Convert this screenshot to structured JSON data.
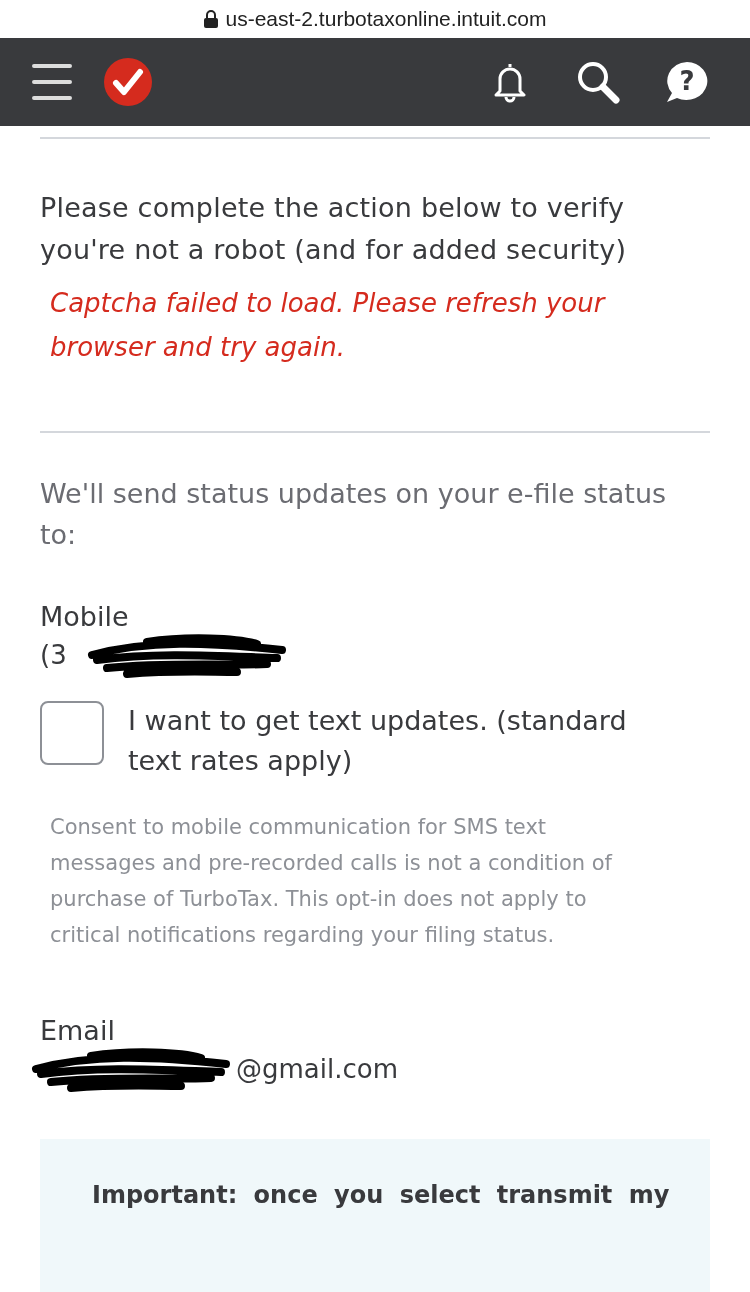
{
  "address_bar": {
    "url": "us-east-2.turbotaxonline.intuit.com"
  },
  "header": {
    "help_symbol": "?"
  },
  "captcha": {
    "prompt": "Please complete the action below to verify you're not a robot (and for added security)",
    "error": "Captcha failed to load. Please refresh your browser and try again."
  },
  "updates": {
    "intro": "We'll send status updates on your e-file status to:",
    "mobile_label": "Mobile",
    "mobile_value": "(3",
    "text_updates": {
      "label": "I want to get text updates. (standard text rates apply)",
      "checked": false
    },
    "consent": "Consent to mobile communication for SMS text messages and pre-recorded calls is not a condition of purchase of TurboTax. This opt-in does not apply to critical notifications regarding your filing status.",
    "email_label": "Email",
    "email_value": "@gmail.com"
  },
  "notice": {
    "text": "Important: once you select transmit my"
  }
}
